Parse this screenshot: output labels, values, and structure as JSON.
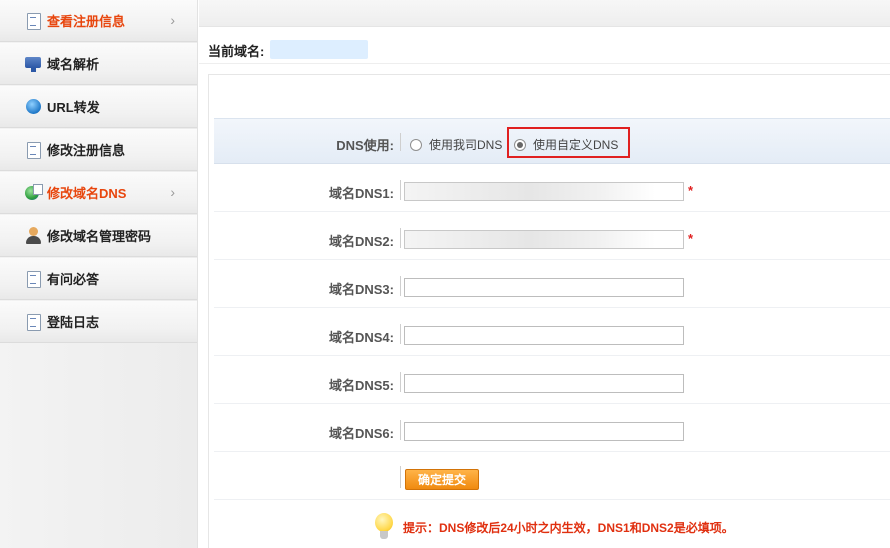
{
  "sidebar": {
    "items": [
      {
        "label": "查看注册信息",
        "icon": "document-icon"
      },
      {
        "label": "域名解析",
        "icon": "network-icon"
      },
      {
        "label": "URL转发",
        "icon": "globe-icon"
      },
      {
        "label": "修改注册信息",
        "icon": "document-edit-icon"
      },
      {
        "label": "修改域名DNS",
        "icon": "globe-dns-icon"
      },
      {
        "label": "修改域名管理密码",
        "icon": "user-icon"
      },
      {
        "label": "有问必答",
        "icon": "document-icon"
      },
      {
        "label": "登陆日志",
        "icon": "document-icon"
      }
    ]
  },
  "current_domain": {
    "label": "当前域名:",
    "value": ""
  },
  "dns_form": {
    "dns_use_label": "DNS使用:",
    "option_ours": "使用我司DNS",
    "option_custom": "使用自定义DNS",
    "selected": "custom",
    "fields": [
      {
        "label": "域名DNS1:",
        "value": "",
        "required": "*"
      },
      {
        "label": "域名DNS2:",
        "value": "",
        "required": "*"
      },
      {
        "label": "域名DNS3:",
        "value": ""
      },
      {
        "label": "域名DNS4:",
        "value": ""
      },
      {
        "label": "域名DNS5:",
        "value": ""
      },
      {
        "label": "域名DNS6:",
        "value": ""
      }
    ],
    "submit_label": "确定提交",
    "tip": "提示：DNS修改后24小时之内生效，DNS1和DNS2是必填项。"
  },
  "colors": {
    "accent": "#e8460e",
    "highlight": "#e02020",
    "button": "#f08a10"
  }
}
